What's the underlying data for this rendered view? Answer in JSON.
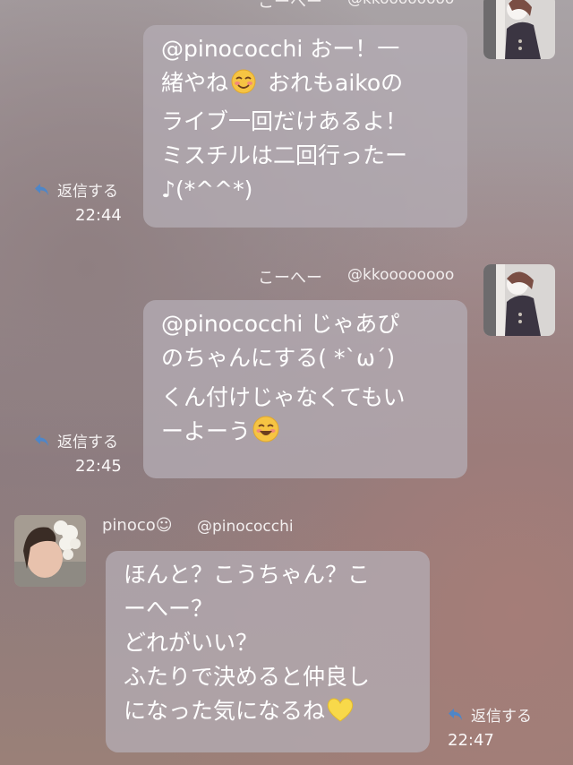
{
  "messages": [
    {
      "sender_name": "こーへー",
      "sender_handle": "@kkoooooooo",
      "lines": [
        "@pinococchi おー！一",
        "緒やね",
        "おれもaikoの",
        "ライブ一回だけあるよ！",
        "ミスチルは二回行ったー",
        "♪(*^^*)"
      ],
      "emoji": "smiling-face-icon",
      "reply_label": "返信する",
      "time": "22:44"
    },
    {
      "sender_name": "こーへー",
      "sender_handle": "@kkoooooooo",
      "lines": [
        "@pinococchi じゃあぴ",
        "のちゃんにする( *`ω´)",
        "くん付けじゃなくてもい",
        "ーよーう"
      ],
      "emoji": "grinning-face-icon",
      "reply_label": "返信する",
      "time": "22:45"
    },
    {
      "sender_name": "pinoco☺",
      "sender_handle": "@pinococchi",
      "lines": [
        "ほんと？こうちゃん？こ",
        "ーへー？",
        "どれがいい？",
        "ふたりで決めると仲良し",
        "になった気になるね"
      ],
      "emoji": "yellow-heart-icon",
      "reply_label": "返信する",
      "time": "22:47"
    }
  ]
}
